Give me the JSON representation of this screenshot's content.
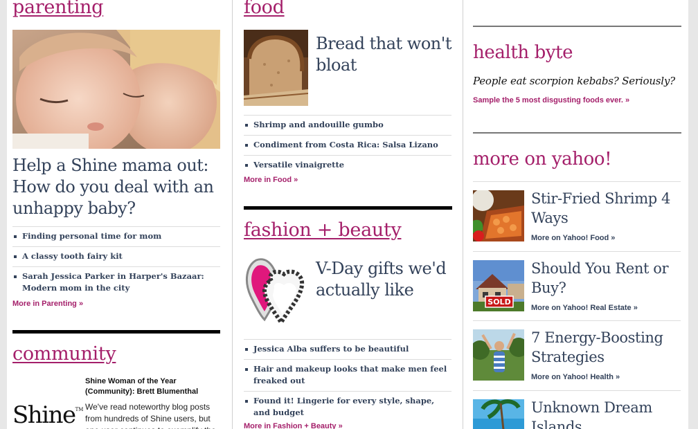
{
  "parenting": {
    "section_title": "parenting",
    "headline": "Help a Shine mama out: How do you deal with an unhappy baby?",
    "bullets": [
      "Finding personal time for mom",
      "A classy tooth fairy kit",
      "Sarah Jessica Parker in Harper's Bazaar: Modern mom in the city"
    ],
    "more": "More in Parenting »"
  },
  "community": {
    "section_title": "community",
    "logo_text": "Shine",
    "logo_tm": "TM",
    "woy_title": "Shine Woman of the Year (Community): Brett Blumenthal",
    "woy_body": "We've read noteworthy blog posts from hundreds of Shine users, but one user continues to exemplify the"
  },
  "food": {
    "section_title": "food",
    "headline": "Bread that won't bloat",
    "bullets": [
      "Shrimp and andouille gumbo",
      "Condiment from Costa Rica: Salsa Lizano",
      "Versatile vinaigrette"
    ],
    "more": "More in Food »"
  },
  "fashion": {
    "section_title": "fashion + beauty",
    "headline": "V-Day gifts we'd actually like",
    "bullets": [
      "Jessica Alba suffers to be beautiful",
      "Hair and makeup looks that make men feel freaked out",
      "Found it! Lingerie for every style, shape, and budget"
    ],
    "more": "More in Fashion + Beauty »"
  },
  "health": {
    "section_title": "health byte",
    "question": "People eat scorpion kebabs? Seriously?",
    "link": "Sample the 5 most disgusting foods ever. »"
  },
  "yahoo": {
    "section_title": "more on yahoo!",
    "items": [
      {
        "title": "Stir-Fried Shrimp 4 Ways",
        "sub": "More on Yahoo! Food »"
      },
      {
        "title": "Should You Rent or Buy?",
        "sub": "More on Yahoo! Real Estate »"
      },
      {
        "title": "7 Energy-Boosting Strategies",
        "sub": "More on Yahoo! Health »"
      },
      {
        "title": "Unknown Dream Islands",
        "sub": ""
      }
    ],
    "sold_sign": "SOLD"
  },
  "colors": {
    "accent": "#a41f6a",
    "headline": "#33425a"
  }
}
